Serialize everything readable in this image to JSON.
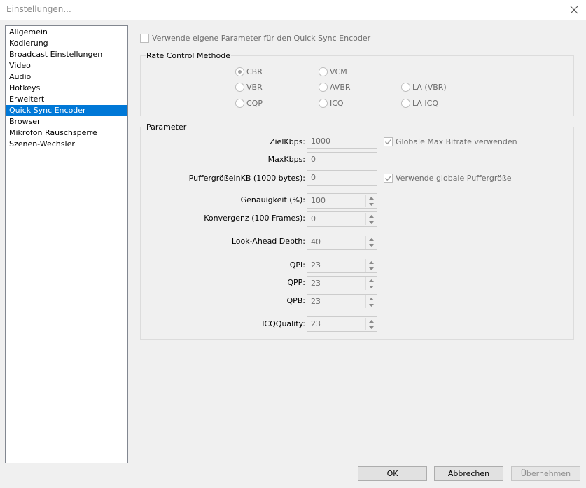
{
  "window": {
    "title": "Einstellungen..."
  },
  "sidebar": {
    "items": [
      {
        "label": "Allgemein"
      },
      {
        "label": "Kodierung"
      },
      {
        "label": "Broadcast Einstellungen"
      },
      {
        "label": "Video"
      },
      {
        "label": "Audio"
      },
      {
        "label": "Hotkeys"
      },
      {
        "label": "Erweitert"
      },
      {
        "label": "Quick Sync Encoder",
        "selected": true
      },
      {
        "label": "Browser"
      },
      {
        "label": "Mikrofon Rauschsperre"
      },
      {
        "label": "Szenen-Wechsler"
      }
    ]
  },
  "main": {
    "custom_params_label": "Verwende eigene Parameter für den Quick Sync Encoder",
    "rate_control": {
      "title": "Rate Control Methode",
      "options": [
        {
          "label": "CBR",
          "selected": true
        },
        {
          "label": "VCM"
        },
        {
          "label": "VBR"
        },
        {
          "label": "AVBR"
        },
        {
          "label": "LA (VBR)"
        },
        {
          "label": "CQP"
        },
        {
          "label": "ICQ"
        },
        {
          "label": "LA ICQ"
        }
      ]
    },
    "parameters": {
      "title": "Parameter",
      "zielkbps": {
        "label": "ZielKbps:",
        "value": "1000"
      },
      "maxkbps": {
        "label": "MaxKbps:",
        "value": "0"
      },
      "puffer": {
        "label": "PuffergrößeInKB (1000 bytes):",
        "value": "0"
      },
      "global_bitrate_label": "Globale Max Bitrate verwenden",
      "global_buffer_label": "Verwende globale Puffergröße",
      "genauigkeit": {
        "label": "Genauigkeit (%):",
        "value": "100"
      },
      "konvergenz": {
        "label": "Konvergenz (100 Frames):",
        "value": "0"
      },
      "lookahead": {
        "label": "Look-Ahead Depth:",
        "value": "40"
      },
      "qpi": {
        "label": "QPI:",
        "value": "23"
      },
      "qpp": {
        "label": "QPP:",
        "value": "23"
      },
      "qpb": {
        "label": "QPB:",
        "value": "23"
      },
      "icqquality": {
        "label": "ICQQuality:",
        "value": "23"
      }
    }
  },
  "buttons": {
    "ok": "OK",
    "cancel": "Abbrechen",
    "apply": "Übernehmen"
  }
}
